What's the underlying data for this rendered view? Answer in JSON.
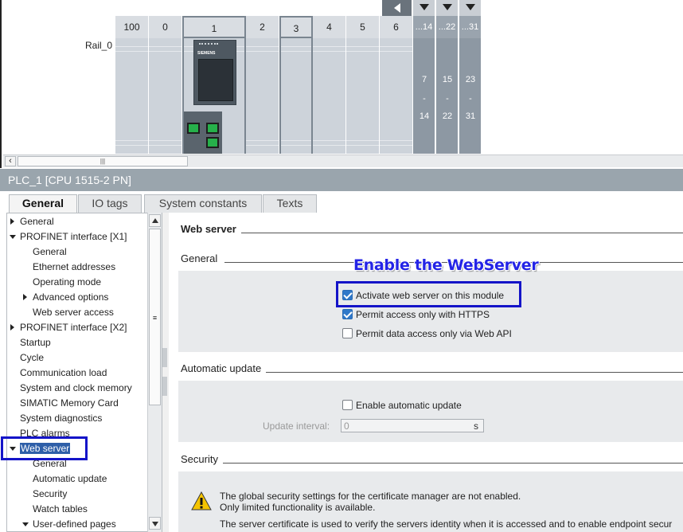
{
  "device_view": {
    "rail_label": "Rail_0",
    "slots": [
      "100",
      "0",
      "1",
      "2",
      "3",
      "4",
      "5",
      "6"
    ],
    "collapsed_slots": [
      {
        "header": "...14",
        "range_start": "7",
        "range_sep": "-",
        "range_end": "14"
      },
      {
        "header": "...22",
        "range_start": "15",
        "range_sep": "-",
        "range_end": "22"
      },
      {
        "header": "...31",
        "range_start": "23",
        "range_sep": "-",
        "range_end": "31"
      }
    ],
    "cpu_brand": "SIEMENS",
    "scroll_grip": "|||"
  },
  "inspector": {
    "title": "PLC_1 [CPU 1515-2 PN]",
    "tabs": [
      {
        "label": "General"
      },
      {
        "label": "IO tags"
      },
      {
        "label": "System constants"
      },
      {
        "label": "Texts"
      }
    ]
  },
  "tree": {
    "items": [
      {
        "label": "General"
      },
      {
        "label": "PROFINET interface [X1]"
      },
      {
        "label": "General"
      },
      {
        "label": "Ethernet addresses"
      },
      {
        "label": "Operating mode"
      },
      {
        "label": "Advanced options"
      },
      {
        "label": "Web server access"
      },
      {
        "label": "PROFINET interface [X2]"
      },
      {
        "label": "Startup"
      },
      {
        "label": "Cycle"
      },
      {
        "label": "Communication load"
      },
      {
        "label": "System and clock memory"
      },
      {
        "label": "SIMATIC Memory Card"
      },
      {
        "label": "System diagnostics"
      },
      {
        "label": "PLC alarms"
      },
      {
        "label": "Web server"
      },
      {
        "label": "General"
      },
      {
        "label": "Automatic update"
      },
      {
        "label": "Security"
      },
      {
        "label": "Watch tables"
      },
      {
        "label": "User-defined pages"
      }
    ]
  },
  "content": {
    "heading": "Web server",
    "general_section": {
      "title": "General",
      "options": [
        {
          "label": "Activate web server on this module",
          "checked": true
        },
        {
          "label": "Permit access only with HTTPS",
          "checked": true
        },
        {
          "label": "Permit data access only via Web API",
          "checked": false
        }
      ]
    },
    "auto_update_section": {
      "title": "Automatic update",
      "enable_label": "Enable automatic update",
      "enable_checked": false,
      "interval_label": "Update interval:",
      "interval_value": "0",
      "interval_unit": "s"
    },
    "security_section": {
      "title": "Security",
      "warning_line1": "The global security settings for the certificate manager are not enabled.",
      "warning_line2": "Only limited functionality is available.",
      "info_line": "The server certificate is used to verify the servers identity when it is accessed and to enable endpoint secur"
    }
  },
  "annotation": {
    "text": "Enable the WebServer",
    "color": "#1414c8"
  }
}
